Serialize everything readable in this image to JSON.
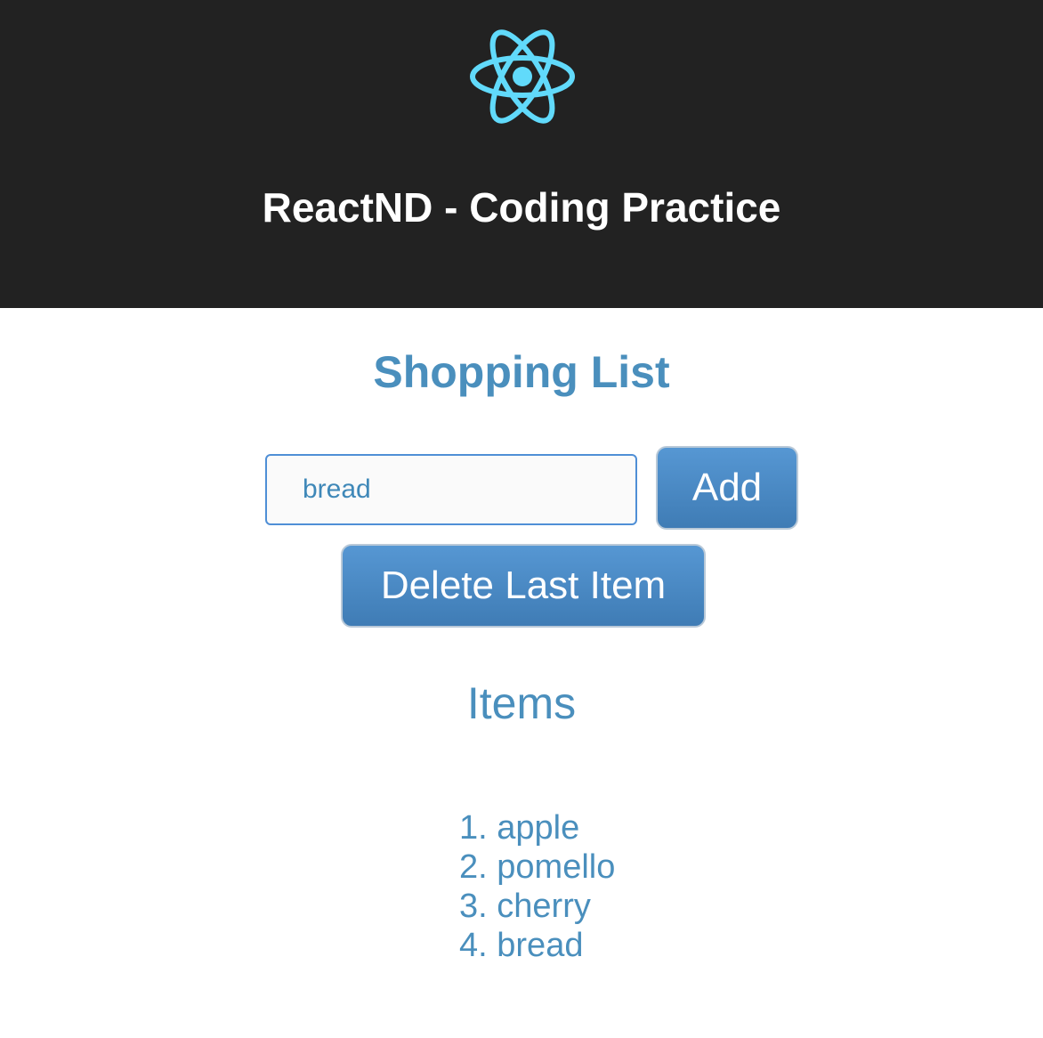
{
  "header": {
    "logo_icon": "react-atom-icon",
    "logo_color": "#61dafb",
    "title": "ReactND - Coding Practice",
    "background": "#222222"
  },
  "main": {
    "title": "Shopping List",
    "input": {
      "value": "bread",
      "placeholder": ""
    },
    "add_button_label": "Add",
    "delete_button_label": "Delete Last Item",
    "items_title": "Items",
    "items": [
      {
        "number": "1.",
        "label": "apple"
      },
      {
        "number": "2.",
        "label": "pomello"
      },
      {
        "number": "3.",
        "label": "cherry"
      },
      {
        "number": "4.",
        "label": "bread"
      }
    ],
    "accent_color": "#4a8fbd"
  }
}
